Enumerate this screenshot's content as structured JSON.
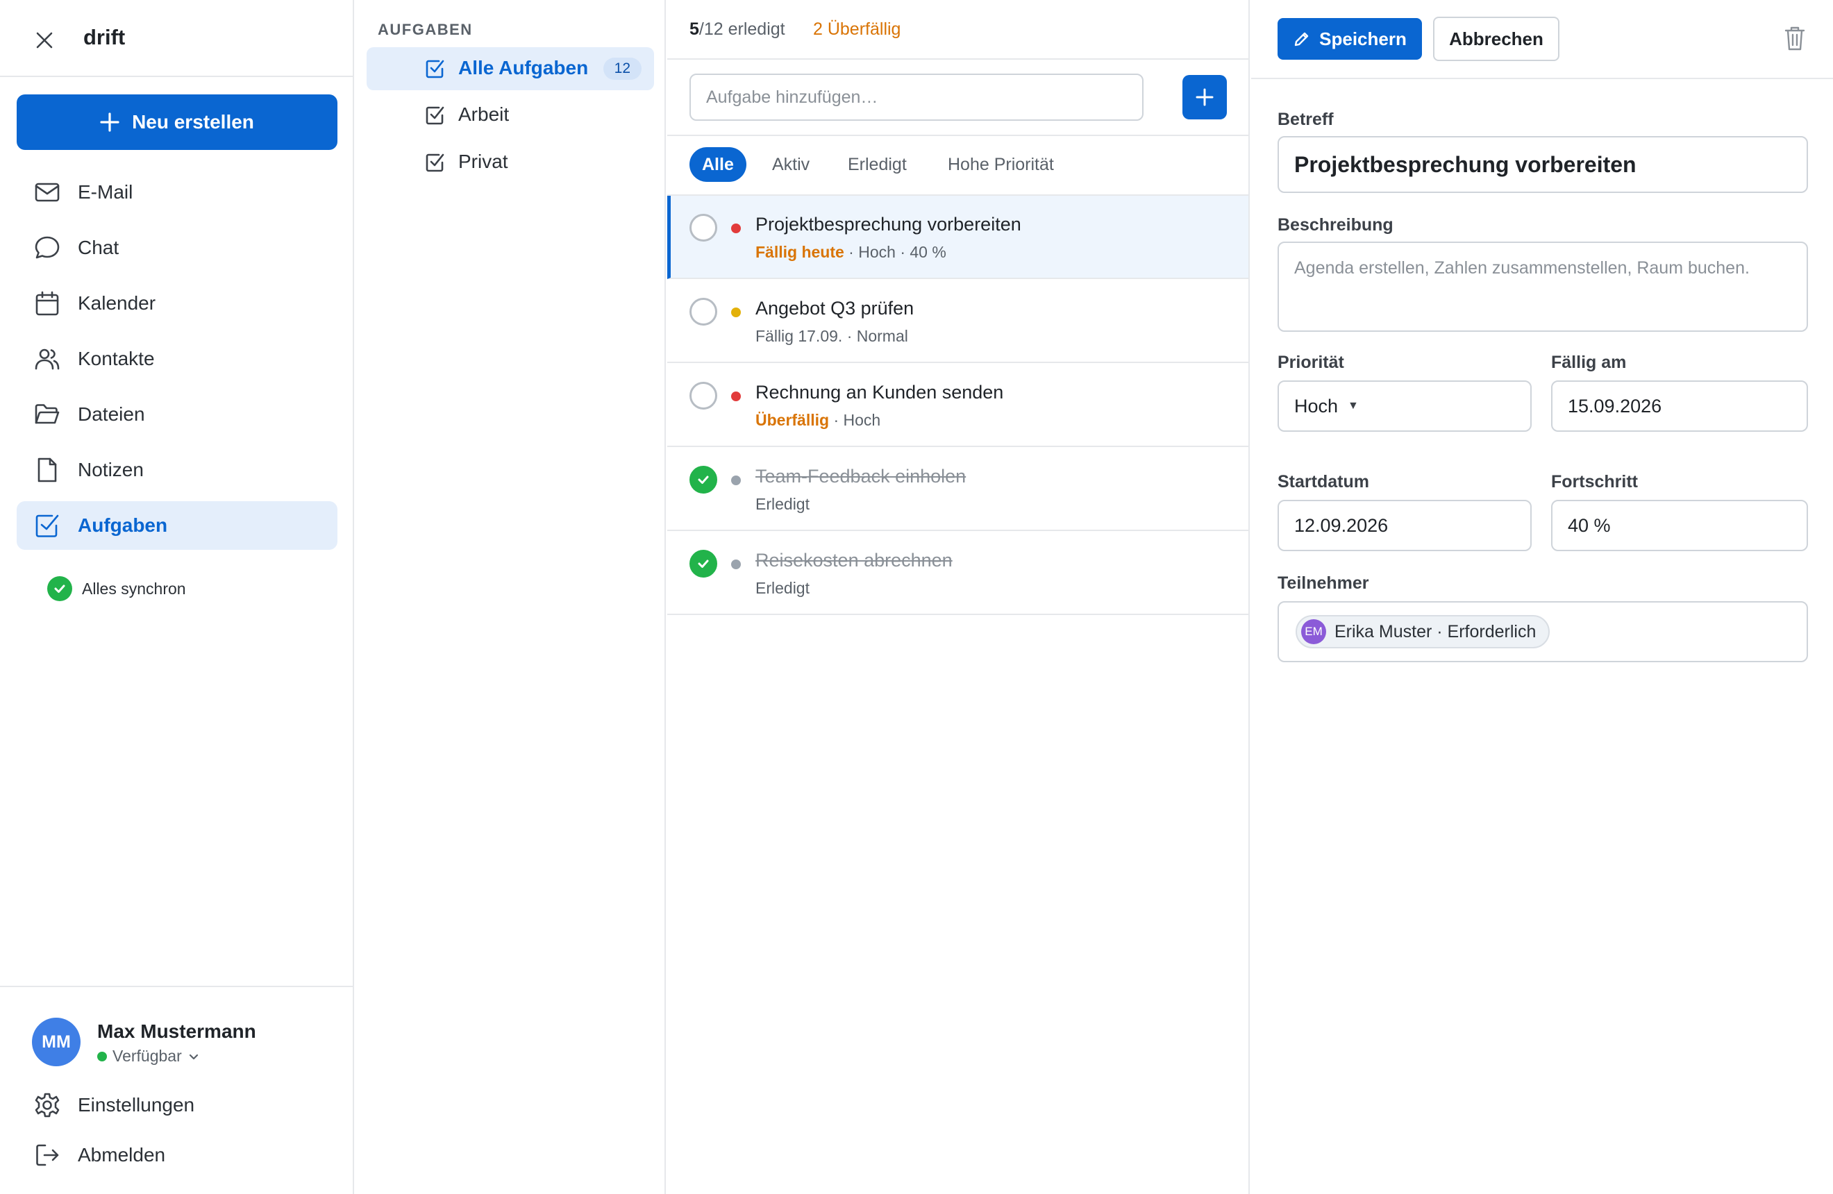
{
  "app": {
    "title": "drift"
  },
  "nav": {
    "new_label": "Neu erstellen",
    "items": [
      {
        "label": "E-Mail",
        "icon": "mail-icon"
      },
      {
        "label": "Chat",
        "icon": "chat-icon"
      },
      {
        "label": "Kalender",
        "icon": "calendar-icon"
      },
      {
        "label": "Kontakte",
        "icon": "contacts-icon"
      },
      {
        "label": "Dateien",
        "icon": "folder-icon"
      },
      {
        "label": "Notizen",
        "icon": "note-icon"
      },
      {
        "label": "Aufgaben",
        "icon": "task-icon",
        "active": true
      }
    ],
    "sync_status": "Alles synchron"
  },
  "user": {
    "initials": "MM",
    "name": "Max Mustermann",
    "status": "Verfügbar",
    "settings_label": "Einstellungen",
    "logout_label": "Abmelden"
  },
  "folders": {
    "title": "AUFGABEN",
    "items": [
      {
        "label": "Alle Aufgaben",
        "count": "12",
        "active": true
      },
      {
        "label": "Arbeit"
      },
      {
        "label": "Privat"
      }
    ]
  },
  "tasks": {
    "done_count": "5",
    "done_total": "/12 erledigt",
    "overdue": "2 Überfällig",
    "add_placeholder": "Aufgabe hinzufügen…",
    "filters": [
      "Alle",
      "Aktiv",
      "Erledigt",
      "Hohe Priorität"
    ],
    "items": [
      {
        "title": "Projektbesprechung vorbereiten",
        "meta_warn": "Fällig heute",
        "meta": " · Hoch · 40 %",
        "priority_color": "#e23b3b",
        "done": false,
        "selected": true
      },
      {
        "title": "Angebot Q3 prüfen",
        "meta_warn": "",
        "meta": "Fällig 17.09. · Normal",
        "priority_color": "#e3b10a",
        "done": false
      },
      {
        "title": "Rechnung an Kunden senden",
        "meta_warn": "Überfällig",
        "meta": " · Hoch",
        "priority_color": "#e23b3b",
        "done": false
      },
      {
        "title": "Team-Feedback einholen",
        "meta_warn": "",
        "meta": "Erledigt",
        "priority_color": "#9aa3ad",
        "done": true
      },
      {
        "title": "Reisekosten abrechnen",
        "meta_warn": "",
        "meta": "Erledigt",
        "priority_color": "#9aa3ad",
        "done": true
      }
    ]
  },
  "detail": {
    "save_label": "Speichern",
    "cancel_label": "Abbrechen",
    "subject_label": "Betreff",
    "subject_value": "Projektbesprechung vorbereiten",
    "description_label": "Beschreibung",
    "description_placeholder": "Agenda erstellen, Zahlen zusammenstellen, Raum buchen.",
    "priority_label": "Priorität",
    "priority_value": "Hoch",
    "due_label": "Fällig am",
    "due_value": "15.09.2026",
    "start_label": "Startdatum",
    "start_value": "12.09.2026",
    "progress_label": "Fortschritt",
    "progress_value": "40 %",
    "attendees_label": "Teilnehmer",
    "attendee_initials": "EM",
    "attendee_text": "Erika Muster · Erforderlich"
  },
  "colors": {
    "accent": "#0a66d1",
    "success": "#22b34a",
    "warning": "#d97406",
    "danger": "#e23b3b"
  }
}
